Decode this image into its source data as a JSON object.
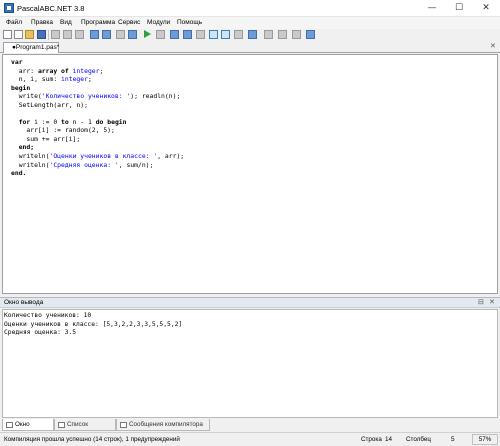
{
  "window": {
    "title": "PascalABC.NET 3.8",
    "minimize_glyph": "—",
    "maximize_glyph": "☐",
    "close_glyph": "✕"
  },
  "menu": [
    "Файл",
    "Правка",
    "Вид",
    "Программа",
    "Сервис",
    "Модули",
    "Помощь"
  ],
  "toolbar": {
    "icons": [
      "new-file-icon",
      "new-window-icon",
      "open-icon",
      "save-icon",
      "save-all-icon",
      "cut-icon",
      "copy-icon",
      "paste-icon",
      "undo-icon",
      "redo-icon",
      "format-icon",
      "find-icon",
      "run-icon",
      "stop-icon",
      "debug-icon",
      "step-icon",
      "layout-icon",
      "layout2-icon",
      "layout3-icon",
      "form-icon",
      "window-icon",
      "tools-icon",
      "help-icon"
    ]
  },
  "editor": {
    "tab_label": "●Program1.pas*",
    "tab_close": "✕"
  },
  "output": {
    "title": "Окно вывода",
    "pin_glyph": "⊟",
    "close_glyph": "✕",
    "lines": [
      "Количество учеников: 10",
      "Оценки учеников в классе: [5,3,2,2,3,3,5,5,5,2]",
      "Средняя оценка: 3.5"
    ]
  },
  "bottom_tabs": [
    "Окно вывода",
    "Список ошибок",
    "Сообщения компилятора"
  ],
  "status": {
    "message": "Компиляция прошла успешно (14 строк), 1 предупреждений",
    "row_label": "Строка",
    "row_value": "14",
    "col_label": "Столбец",
    "col_value": "5",
    "zoom": "57%"
  },
  "code": {
    "l1": "var",
    "l2a": "  arr: ",
    "l2b": "array of",
    "l2c": " integer",
    "l2d": ";",
    "l3a": "  n, i, sum: ",
    "l3b": "integer",
    "l3c": ";",
    "l4": "begin",
    "l5a": "  write(",
    "l5b": "'Количество учеников: '",
    "l5c": "); readln(n);",
    "l6": "  SetLength(arr, n);",
    "l7": "",
    "l8a": "  ",
    "l8b": "for",
    "l8c": " i := ",
    "l8d": "0",
    "l8e": " to",
    "l8f": " n - 1 ",
    "l8g": "do",
    "l8h": " ",
    "l8i": "begin",
    "l9a": "    arr[i] := random(2, 5);",
    "l10": "    sum += arr[i];",
    "l11": "  end;",
    "l12a": "  writeln(",
    "l12b": "'Оценки учеников в классе: '",
    "l12c": ", arr);",
    "l13a": "  writeln(",
    "l13b": "'Средняя оценка: '",
    "l13c": ", sum/n);",
    "l14": "end."
  }
}
